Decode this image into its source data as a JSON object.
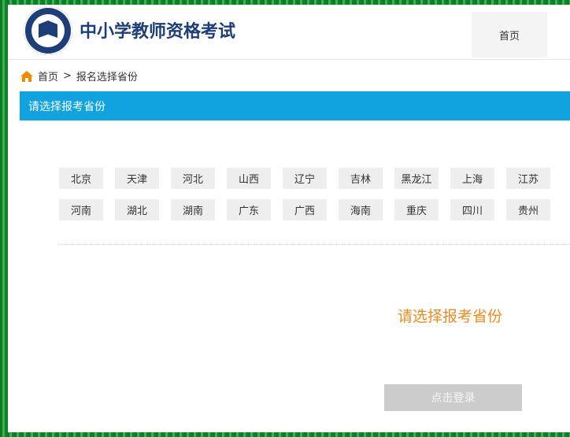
{
  "header": {
    "logo_text": "中小学教师资格考试",
    "site_title": "中小学教师资格考试",
    "home_tab": "首页"
  },
  "breadcrumb": {
    "home": "首页",
    "separator": ">",
    "current": "报名选择省份"
  },
  "section": {
    "title": "请选择报考省份"
  },
  "provinces": [
    "北京",
    "天津",
    "河北",
    "山西",
    "辽宁",
    "吉林",
    "黑龙江",
    "上海",
    "江苏",
    "河南",
    "湖北",
    "湖南",
    "广东",
    "广西",
    "海南",
    "重庆",
    "四川",
    "贵州"
  ],
  "prompt": "请选择报考省份",
  "login_button": "点击登录",
  "colors": {
    "brand_blue": "#1d3e78",
    "section_bar": "#10a3e0",
    "prompt_orange": "#ee8a1e",
    "home_icon": "#f08a00",
    "button_disabled": "#cccccc"
  }
}
